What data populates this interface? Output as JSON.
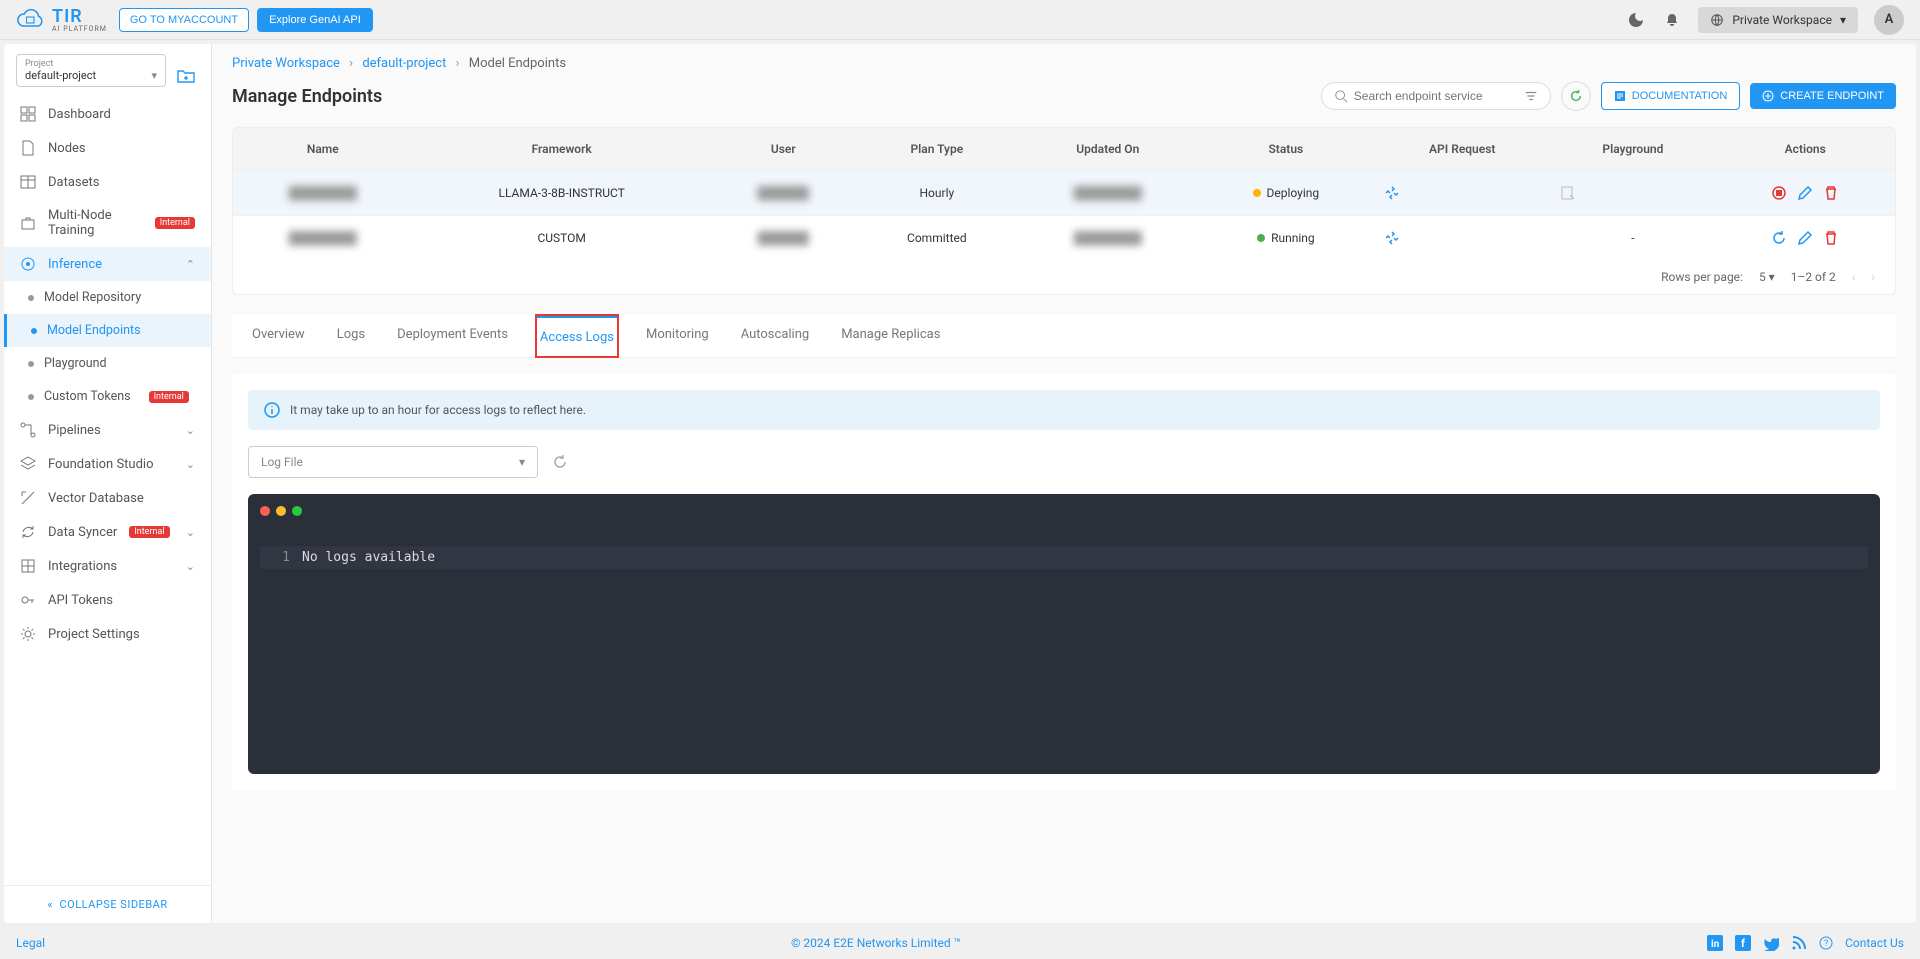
{
  "topbar": {
    "logo_text": "TIR",
    "logo_sub": "AI PLATFORM",
    "btn_myaccount": "GO TO MYACCOUNT",
    "btn_genai": "Explore GenAI API",
    "workspace_label": "Private Workspace",
    "avatar_letter": "A"
  },
  "project": {
    "label": "Project",
    "value": "default-project"
  },
  "sidebar": {
    "items": [
      {
        "label": "Dashboard"
      },
      {
        "label": "Nodes"
      },
      {
        "label": "Datasets"
      },
      {
        "label": "Multi-Node Training",
        "badge": "Internal"
      },
      {
        "label": "Inference",
        "expanded": true
      },
      {
        "label": "Pipelines"
      },
      {
        "label": "Foundation Studio"
      },
      {
        "label": "Vector Database"
      },
      {
        "label": "Data Syncer",
        "badge": "Internal"
      },
      {
        "label": "Integrations"
      },
      {
        "label": "API Tokens"
      },
      {
        "label": "Project Settings"
      }
    ],
    "inference_sub": [
      {
        "label": "Model Repository"
      },
      {
        "label": "Model Endpoints",
        "active": true
      },
      {
        "label": "Playground"
      },
      {
        "label": "Custom Tokens",
        "badge": "Internal"
      }
    ],
    "collapse": "COLLAPSE SIDEBAR"
  },
  "breadcrumb": {
    "workspace": "Private Workspace",
    "project": "default-project",
    "current": "Model Endpoints"
  },
  "page": {
    "title": "Manage Endpoints",
    "search_placeholder": "Search endpoint service",
    "doc_btn": "DOCUMENTATION",
    "create_btn": "CREATE ENDPOINT"
  },
  "table": {
    "headers": [
      "Name",
      "Framework",
      "User",
      "Plan Type",
      "Updated On",
      "Status",
      "API Request",
      "Playground",
      "Actions"
    ],
    "rows": [
      {
        "framework": "LLAMA-3-8B-INSTRUCT",
        "plan": "Hourly",
        "status": "Deploying",
        "status_class": "status-deploying",
        "playground": "icon"
      },
      {
        "framework": "CUSTOM",
        "plan": "Committed",
        "status": "Running",
        "status_class": "status-running",
        "playground": "-"
      }
    ],
    "rows_per_page_label": "Rows per page:",
    "rows_per_page": "5",
    "range": "1–2 of 2"
  },
  "tabs": [
    "Overview",
    "Logs",
    "Deployment Events",
    "Access Logs",
    "Monitoring",
    "Autoscaling",
    "Manage Replicas"
  ],
  "active_tab": "Access Logs",
  "info_banner": "It may take up to an hour for access logs to reflect here.",
  "log_select": "Log File",
  "terminal": {
    "line_no": "1",
    "text": "No logs available"
  },
  "footer": {
    "legal": "Legal",
    "copyright": "© 2024 E2E Networks Limited ™",
    "contact": "Contact Us"
  }
}
